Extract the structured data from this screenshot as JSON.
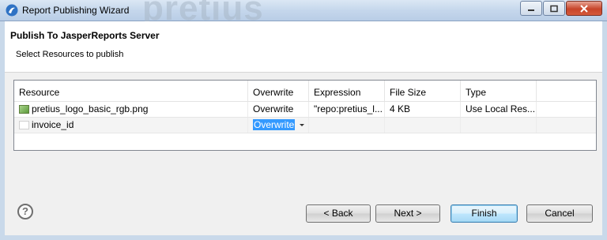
{
  "window": {
    "title": "Report Publishing Wizard",
    "background_text": "pretius"
  },
  "header": {
    "title": "Publish To JasperReports Server",
    "subtitle": "Select Resources to publish"
  },
  "table": {
    "columns": [
      "Resource",
      "Overwrite",
      "Expression",
      "File Size",
      "Type"
    ],
    "rows": [
      {
        "resource": "pretius_logo_basic_rgb.png",
        "overwrite": "Overwrite",
        "expression": "\"repo:pretius_l...",
        "file_size": "4 KB",
        "type": "Use Local Res..."
      },
      {
        "resource": "invoice_id",
        "overwrite": "Overwrite",
        "expression": "",
        "file_size": "",
        "type": ""
      }
    ]
  },
  "buttons": {
    "back": "< Back",
    "next": "Next >",
    "finish": "Finish",
    "cancel": "Cancel"
  },
  "colors": {
    "selection": "#3399ff",
    "title_bar": "#c5d7ec",
    "close_button": "#c7452a"
  }
}
